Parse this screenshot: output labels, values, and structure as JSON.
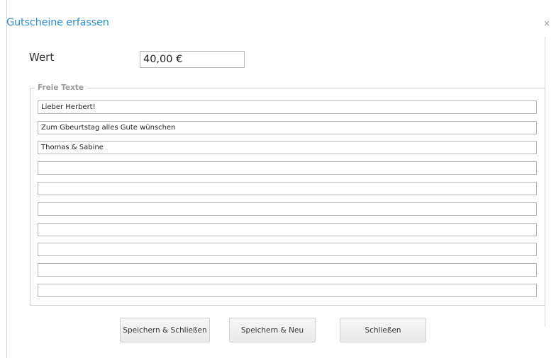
{
  "dialog": {
    "title": "Gutscheine erfassen",
    "close_glyph": "×"
  },
  "wert": {
    "label": "Wert",
    "value": "40,00 €"
  },
  "freie_texte": {
    "legend": "Freie Texte",
    "lines": [
      "Lieber Herbert!",
      "Zum Gbeurtstag alles Gute wünschen",
      "Thomas & Sabine",
      "",
      "",
      "",
      "",
      "",
      "",
      ""
    ]
  },
  "buttons": {
    "save_close": "Speichern & Schließen",
    "save_new": "Speichern & Neu",
    "close": "Schließen"
  },
  "colors": {
    "title": "#2b8fc9",
    "border": "#b7b7b7"
  }
}
